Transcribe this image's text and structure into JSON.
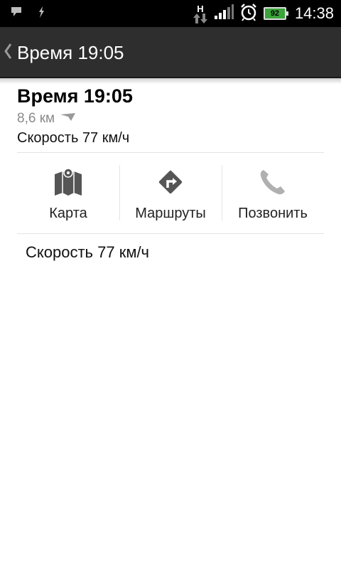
{
  "status_bar": {
    "time": "14:38",
    "battery_level": "92",
    "network_label": "H",
    "icons": [
      "notification-icon",
      "usb-icon",
      "data-activity-icon",
      "signal-icon",
      "alarm-icon",
      "battery-icon"
    ]
  },
  "action_bar": {
    "back_icon": "chevron-left-icon",
    "title": "Время 19:05"
  },
  "info": {
    "title": "Время 19:05",
    "distance": "8,6 км",
    "direction_icon": "direction-arrow-icon",
    "speed": "Скорость 77 км/ч"
  },
  "actions": [
    {
      "label": "Карта",
      "icon": "map-icon"
    },
    {
      "label": "Маршруты",
      "icon": "route-icon"
    },
    {
      "label": "Позвонить",
      "icon": "phone-icon"
    }
  ],
  "note": "Скорость 77 км/ч",
  "colors": {
    "status_bar_bg": "#000000",
    "action_bar_bg": "#2e2e2e",
    "icon_gray": "#555555",
    "phone_icon_gray": "#b0b0b0",
    "secondary_text": "#8a8a8a"
  }
}
